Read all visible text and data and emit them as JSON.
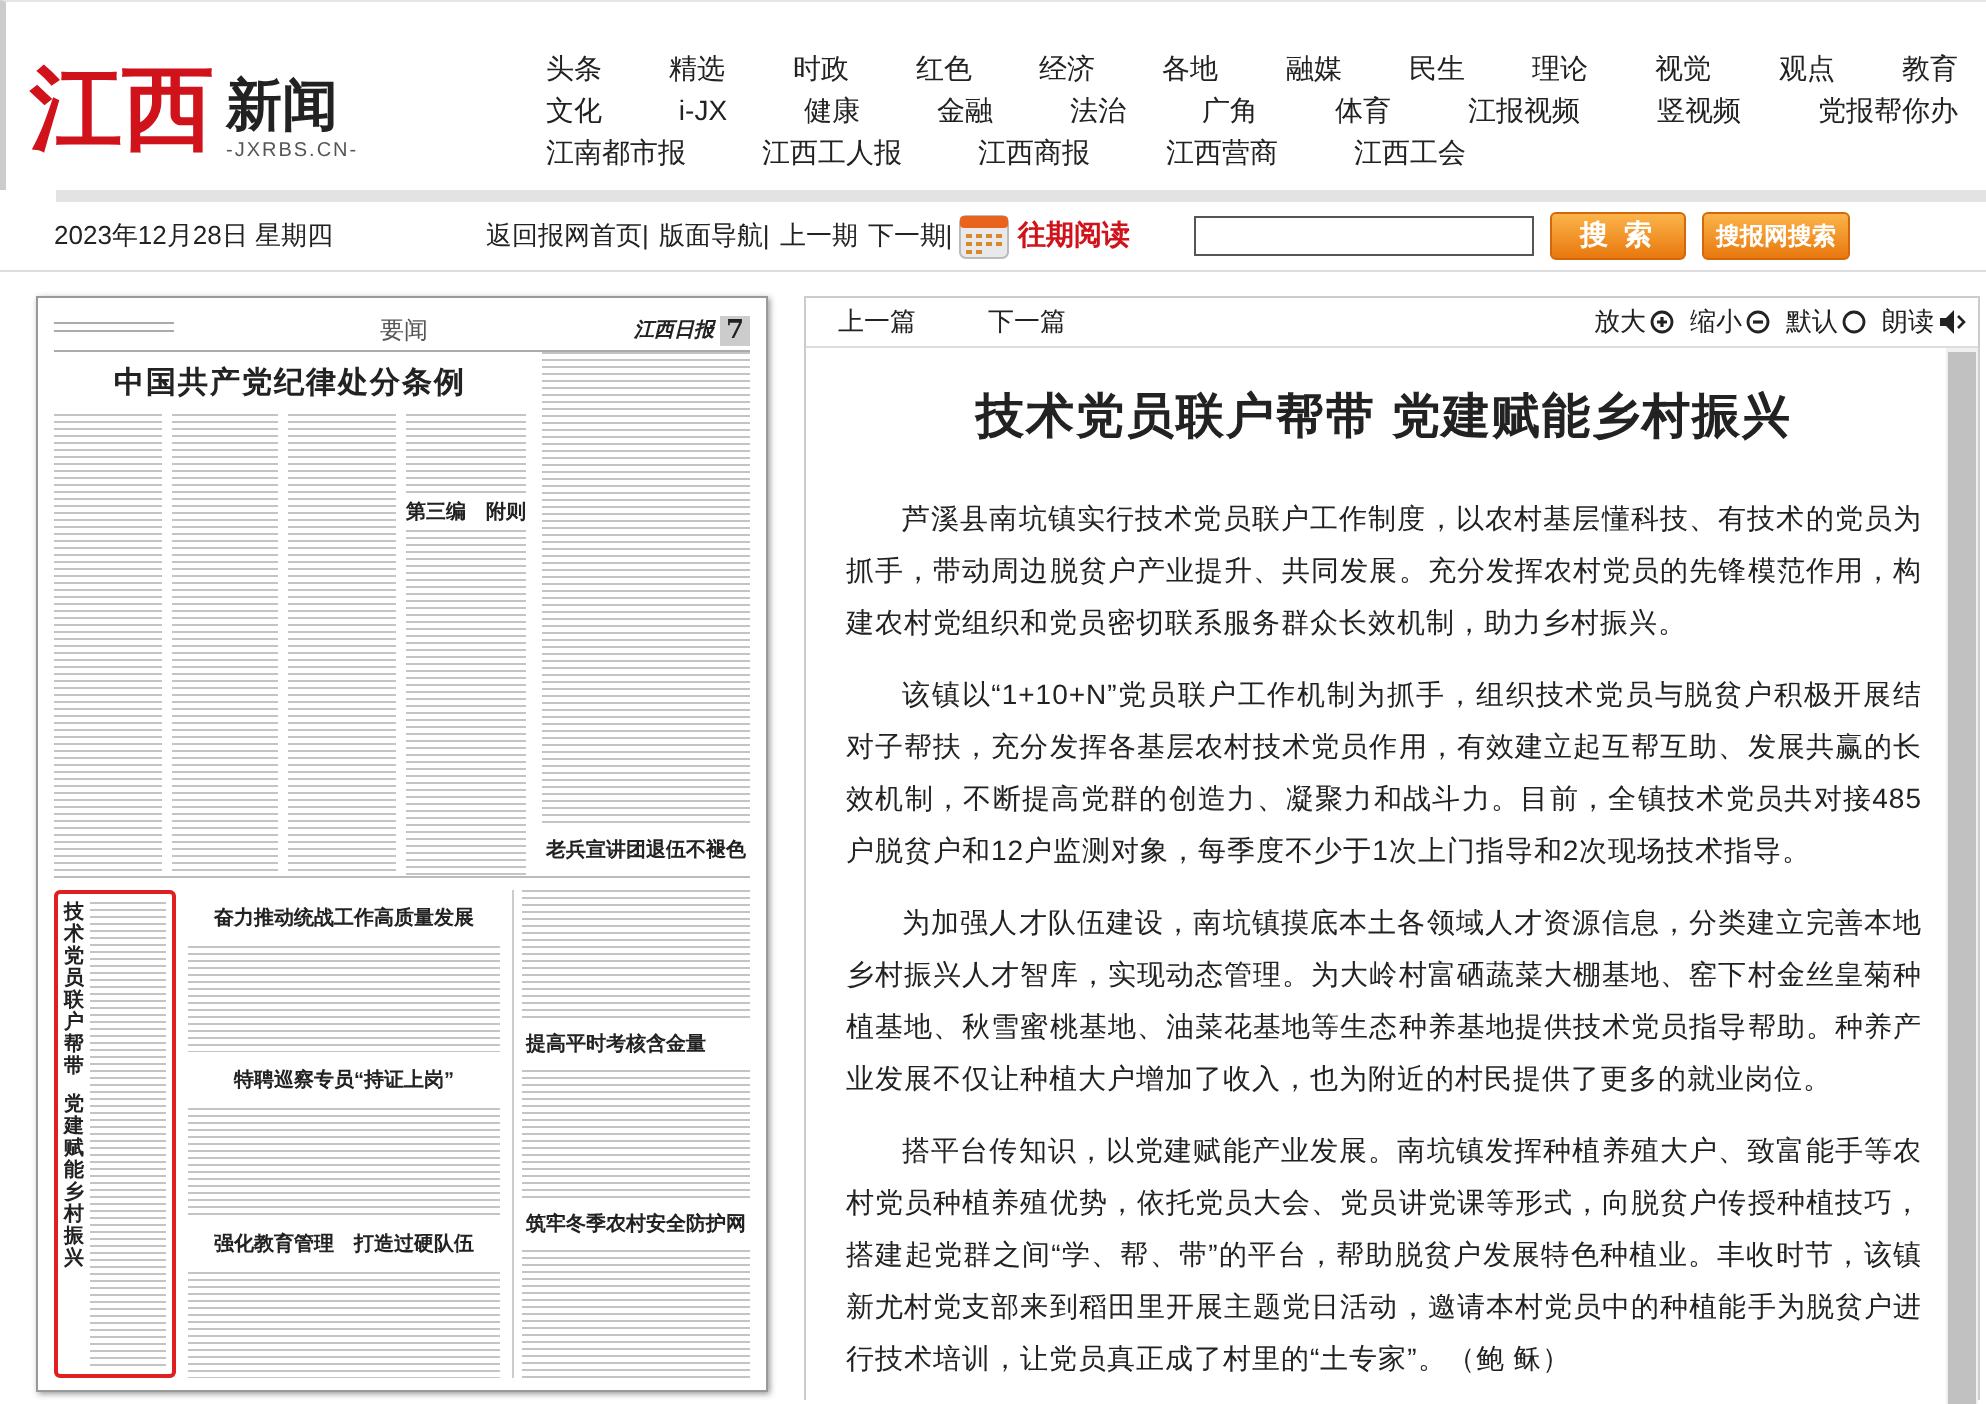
{
  "logo": {
    "mark": "江西",
    "name": "新闻",
    "domain": "-JXRBS.CN-"
  },
  "nav": {
    "channels": [
      "头条",
      "精选",
      "时政",
      "红色",
      "经济",
      "各地",
      "融媒",
      "民生",
      "理论",
      "视觉",
      "观点",
      "教育"
    ],
    "topics": [
      "文化",
      "i-JX",
      "健康",
      "金融",
      "法治",
      "广角",
      "体育",
      "江报视频",
      "竖视频",
      "党报帮你办"
    ],
    "partners": [
      "江南都市报",
      "江西工人报",
      "江西商报",
      "江西营商",
      "江西工会"
    ]
  },
  "toolbar": {
    "date": "2023年12月28日 星期四",
    "links": [
      "返回报网首页|",
      "版面导航|",
      "上一期",
      "下一期|"
    ],
    "archive": "往期阅读",
    "search_button": "搜 索",
    "site_search_button": "搜报网搜索"
  },
  "page": {
    "section": "要闻",
    "masthead": "江西日报",
    "number": "7",
    "lead": {
      "title": "中国共产党纪律处分条例",
      "selected": false
    },
    "subheading": "第三编　附则",
    "side": {
      "title": "老兵宣讲团退伍不褪色",
      "selected": false
    },
    "vertical": {
      "title_lines": [
        "技术党员联户帮带",
        "党建赋能乡村振兴"
      ],
      "selected": true
    },
    "middle": [
      {
        "title": "奋力推动统战工作高质量发展",
        "selected": false
      },
      {
        "title": "特聘巡察专员“持证上岗”",
        "selected": false
      },
      {
        "title": "强化教育管理　打造过硬队伍",
        "selected": false
      }
    ],
    "right": [
      {
        "title": "提高平时考核含金量",
        "selected": false
      },
      {
        "title": "筑牢冬季农村安全防护网",
        "selected": false
      }
    ]
  },
  "article_toolbar": {
    "prev": "上一篇",
    "next": "下一篇",
    "zoom_in": "放大",
    "zoom_out": "缩小",
    "reset": "默认",
    "read_aloud": "朗读"
  },
  "article": {
    "title": "技术党员联户帮带 党建赋能乡村振兴",
    "paragraphs": [
      "芦溪县南坑镇实行技术党员联户工作制度，以农村基层懂科技、有技术的党员为抓手，带动周边脱贫户产业提升、共同发展。充分发挥农村党员的先锋模范作用，构建农村党组织和党员密切联系服务群众长效机制，助力乡村振兴。",
      "该镇以“1+10+N”党员联户工作机制为抓手，组织技术党员与脱贫户积极开展结对子帮扶，充分发挥各基层农村技术党员作用，有效建立起互帮互助、发展共赢的长效机制，不断提高党群的创造力、凝聚力和战斗力。目前，全镇技术党员共对接485户脱贫户和12户监测对象，每季度不少于1次上门指导和2次现场技术指导。",
      "为加强人才队伍建设，南坑镇摸底本土各领域人才资源信息，分类建立完善本地乡村振兴人才智库，实现动态管理。为大岭村富硒蔬菜大棚基地、窑下村金丝皇菊种植基地、秋雪蜜桃基地、油菜花基地等生态种养基地提供技术党员指导帮助。种养产业发展不仅让种植大户增加了收入，也为附近的村民提供了更多的就业岗位。",
      "搭平台传知识，以党建赋能产业发展。南坑镇发挥种植养殖大户、致富能手等农村党员种植养殖优势，依托党员大会、党员讲党课等形式，向脱贫户传授种植技巧，搭建起党群之间“学、帮、带”的平台，帮助脱贫户发展特色种植业。丰收时节，该镇新尤村党支部来到稻田里开展主题党日活动，邀请本村党员中的种植能手为脱贫户进行技术培训，让党员真正成了村里的“土专家”。（鲍 稣）"
    ]
  }
}
